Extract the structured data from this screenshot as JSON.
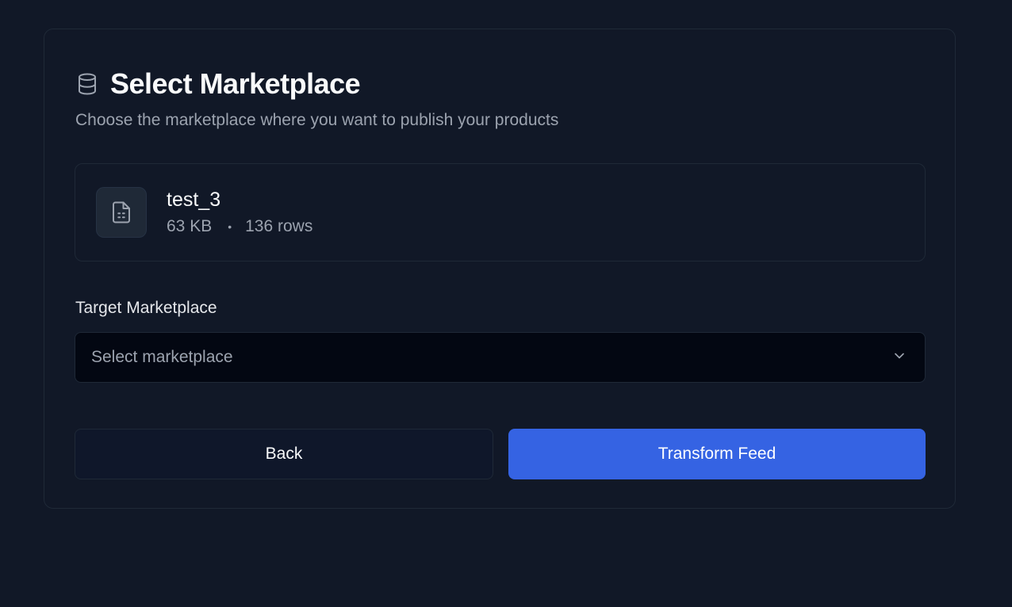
{
  "header": {
    "icon": "database-icon",
    "title": "Select Marketplace",
    "subtitle": "Choose the marketplace where you want to publish your products"
  },
  "file": {
    "icon": "file-spreadsheet-icon",
    "name": "test_3",
    "size": "63 KB",
    "separator": "•",
    "rows": "136 rows"
  },
  "marketplace": {
    "label": "Target Marketplace",
    "placeholder": "Select marketplace",
    "icon": "chevron-down-icon"
  },
  "actions": {
    "back_label": "Back",
    "transform_label": "Transform Feed"
  },
  "colors": {
    "background": "#111827",
    "primary": "#3563e3",
    "muted_text": "#9ca3af",
    "border": "#1f2937"
  }
}
